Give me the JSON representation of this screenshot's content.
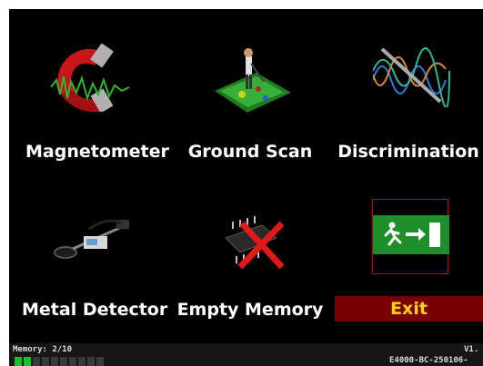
{
  "menu": {
    "items": [
      {
        "label": "Magnetometer",
        "icon": "magnet-icon"
      },
      {
        "label": "Ground  Scan",
        "icon": "ground-scan-icon"
      },
      {
        "label": "Discrimination",
        "icon": "wave-graph-icon"
      },
      {
        "label": "Metal  Detector",
        "icon": "metal-detector-icon"
      },
      {
        "label": "Empty  Memory",
        "icon": "memory-chip-icon"
      },
      {
        "label": "Exit",
        "icon": "exit-sign-icon"
      }
    ]
  },
  "status": {
    "memory_label": "Memory: 2/10",
    "version": "V1.",
    "device_code": "E4000-BC-250106-",
    "memory_used": 2,
    "memory_total": 10
  },
  "colors": {
    "background": "#000000",
    "exit_bar": "#7a0000",
    "exit_text": "#ffd400",
    "exit_sign_green": "#1e8e2a",
    "memory_used": "#11c22a"
  }
}
